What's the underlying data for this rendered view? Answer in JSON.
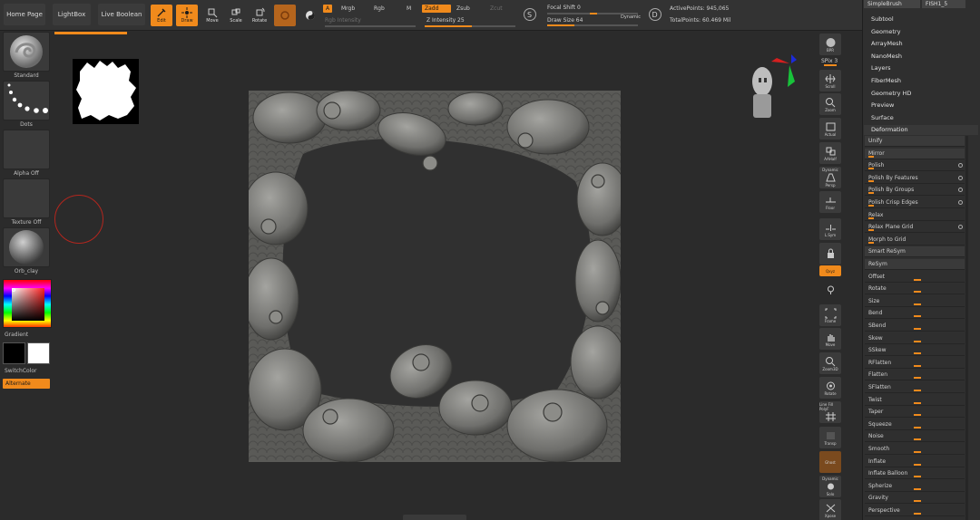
{
  "topbar": {
    "home_page": "Home Page",
    "lightbox": "LightBox",
    "live_boolean": "Live Boolean",
    "tools": {
      "edit": "Edit",
      "draw": "Draw",
      "move": "Move",
      "scale": "Scale",
      "rotate": "Rotate"
    },
    "channels": {
      "a": "A",
      "mrgb": "Mrgb",
      "rgb": "Rgb",
      "m": "M"
    },
    "rgb_intensity": "Rgb Intensity",
    "zadd": "Zadd",
    "zsub": "Zsub",
    "zcut": "Zcut",
    "z_intensity": "Z Intensity 25",
    "focal_shift": "Focal Shift 0",
    "draw_size": "Draw Size 64",
    "dynamic": "Dynamic",
    "active_points": "ActivePoints: 945,065",
    "total_points": "TotalPoints: 60.469 Mil"
  },
  "left": {
    "brush": "Standard",
    "stroke": "Dots",
    "alpha": "Alpha Off",
    "texture": "Texture Off",
    "material": "Orb_clay",
    "gradient": "Gradient",
    "switch_color": "SwitchColor",
    "alternate": "Alternate"
  },
  "shelf": {
    "brill": "BPR",
    "spix": "SPix 3",
    "scroll": "Scroll",
    "zoom": "Zoom",
    "actual": "Actual",
    "aahalf": "AAHalf",
    "dynamic": "Dynamic",
    "persp": "Persp",
    "floor": "Floor",
    "lsym": "L.Sym",
    "xyz": "Qxyz",
    "frame": "Frame",
    "move": "Move",
    "zoom3d": "Zoom3D",
    "rotate": "Rotate",
    "linefill": "Line Fill PolyF",
    "transp": "Transp",
    "ghost": "Ghost",
    "solo": "Solo",
    "dynamic2": "Dynamic",
    "xpose": "Xpose"
  },
  "rightpanel": {
    "brush_name": "SimpleBrush",
    "tool_name": "FISH1_5",
    "menu": [
      "Subtool",
      "Geometry",
      "ArrayMesh",
      "NanoMesh",
      "Layers",
      "FiberMesh",
      "Geometry HD",
      "Preview",
      "Surface"
    ],
    "deformation": "Deformation",
    "deform_items": [
      "Unify",
      "Mirror",
      "Polish",
      "Polish By Features",
      "Polish By Groups",
      "Polish Crisp Edges",
      "Relax",
      "Relax Plane Grid",
      "Morph to Grid",
      "Smart ReSym",
      "ReSym",
      "Offset",
      "Rotate",
      "Size",
      "Bend",
      "SBend",
      "Skew",
      "SSkew",
      "RFlatten",
      "Flatten",
      "SFlatten",
      "Twist",
      "Taper",
      "Squeeze",
      "Noise",
      "Smooth",
      "Inflate",
      "Inflate Balloon",
      "Spherize",
      "Gravity",
      "Perspective"
    ]
  }
}
